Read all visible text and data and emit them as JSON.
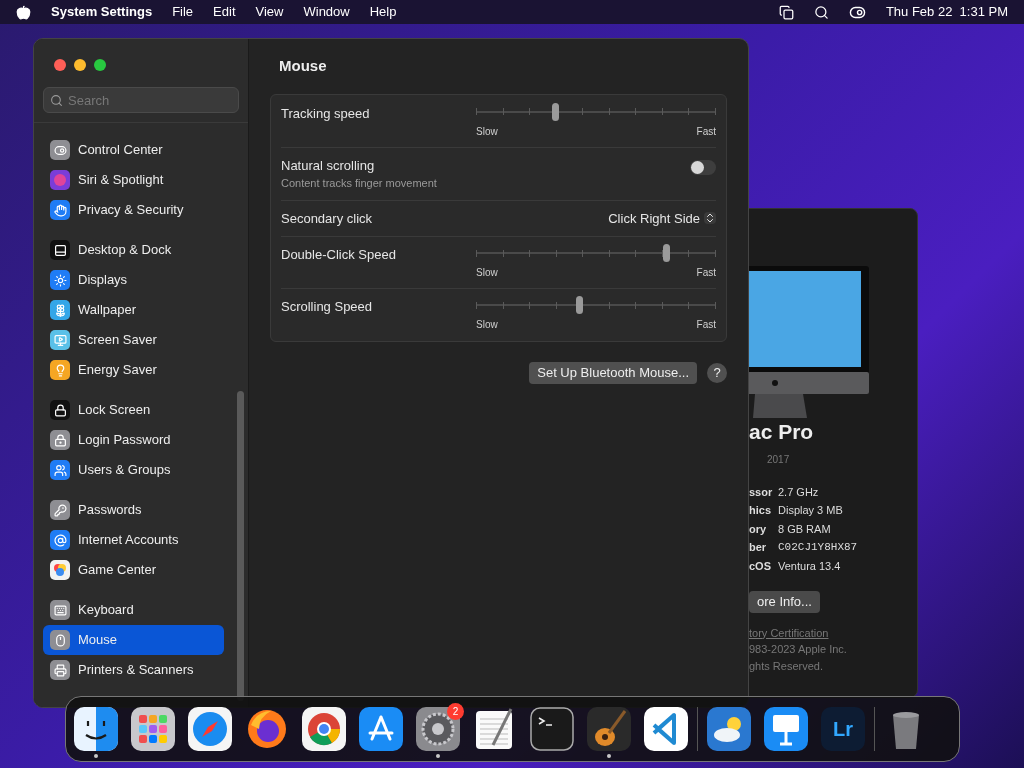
{
  "menu_bar": {
    "app_name": "System Settings",
    "menus": [
      "File",
      "Edit",
      "View",
      "Window",
      "Help"
    ],
    "clock": "Thu Feb 22  1:31 PM"
  },
  "about_window": {
    "model": "ac Pro",
    "year": "2017",
    "specs": [
      {
        "label": "ssor",
        "value": "2.7 GHz"
      },
      {
        "label": "hics",
        "value": "Display 3 MB"
      },
      {
        "label": "ory",
        "value": "8 GB RAM"
      },
      {
        "label": "ber",
        "value": "C02CJ1Y8HX87"
      },
      {
        "label": "cOS",
        "value": "Ventura 13.4"
      }
    ],
    "button": "ore Info...",
    "link": "tory Certification",
    "footer": [
      "983-2023 Apple Inc.",
      "ghts Reserved."
    ]
  },
  "sidebar": {
    "search": {
      "placeholder": "Search"
    },
    "groups": [
      [
        {
          "label": "Control Center",
          "kind": "toggles",
          "color": "#8e8e93",
          "selected": false
        },
        {
          "label": "Siri & Spotlight",
          "kind": "orb",
          "color": "#7a3dd8",
          "selected": false
        },
        {
          "label": "Privacy & Security",
          "kind": "hand",
          "color": "#1f7cf5",
          "selected": false
        }
      ],
      [
        {
          "label": "Desktop & Dock",
          "kind": "dock",
          "color": "#111111",
          "selected": false
        },
        {
          "label": "Displays",
          "kind": "sun",
          "color": "#1f7cf5",
          "selected": false
        },
        {
          "label": "Wallpaper",
          "kind": "flower",
          "color": "#33a6e8",
          "selected": false
        },
        {
          "label": "Screen Saver",
          "kind": "screen",
          "color": "#5ac0e8",
          "selected": false
        },
        {
          "label": "Energy Saver",
          "kind": "bulb",
          "color": "#f5a623",
          "selected": false
        }
      ],
      [
        {
          "label": "Lock Screen",
          "kind": "lock",
          "color": "#111111",
          "selected": false
        },
        {
          "label": "Login Password",
          "kind": "padlock",
          "color": "#8e8e93",
          "selected": false
        },
        {
          "label": "Users & Groups",
          "kind": "users",
          "color": "#1f7cf5",
          "selected": false
        }
      ],
      [
        {
          "label": "Passwords",
          "kind": "key",
          "color": "#8e8e93",
          "selected": false
        },
        {
          "label": "Internet Accounts",
          "kind": "at",
          "color": "#1f7cf5",
          "selected": false
        },
        {
          "label": "Game Center",
          "kind": "bubbles",
          "color": "#f2f2f2",
          "selected": false
        }
      ],
      [
        {
          "label": "Keyboard",
          "kind": "keyboard",
          "color": "#8e8e93",
          "selected": false
        },
        {
          "label": "Mouse",
          "kind": "mouse",
          "color": "#8e8e93",
          "selected": true
        },
        {
          "label": "Printers & Scanners",
          "kind": "printer",
          "color": "#8e8e93",
          "selected": false
        }
      ]
    ]
  },
  "content": {
    "title": "Mouse",
    "rows": [
      {
        "kind": "slider",
        "label": "Tracking speed",
        "level": 0.33,
        "min_label": "Slow",
        "max_label": "Fast"
      },
      {
        "kind": "toggle",
        "label": "Natural scrolling",
        "description": "Content tracks finger movement",
        "on": false
      },
      {
        "kind": "select",
        "label": "Secondary click",
        "value": "Click Right Side"
      },
      {
        "kind": "slider",
        "label": "Double-Click Speed",
        "level": 0.79,
        "min_label": "Slow",
        "max_label": "Fast"
      },
      {
        "kind": "slider",
        "label": "Scrolling Speed",
        "level": 0.43,
        "min_label": "Slow",
        "max_label": "Fast"
      }
    ],
    "button": "Set Up Bluetooth Mouse...",
    "help": "?"
  },
  "dock": [
    [
      {
        "kind": "finder",
        "running": true
      },
      {
        "kind": "launchpad",
        "running": false
      },
      {
        "kind": "safari",
        "running": false
      },
      {
        "kind": "firefox",
        "running": false
      },
      {
        "kind": "chrome",
        "running": false
      },
      {
        "kind": "appstore",
        "running": false
      },
      {
        "kind": "settings",
        "running": true,
        "badge": "2"
      },
      {
        "kind": "textedit",
        "running": false
      },
      {
        "kind": "terminal",
        "running": false
      },
      {
        "kind": "garageband",
        "running": true
      },
      {
        "kind": "vscode",
        "running": false
      }
    ],
    [
      {
        "kind": "weather",
        "running": false
      },
      {
        "kind": "keynote",
        "running": false
      },
      {
        "kind": "lightroom",
        "running": false,
        "text": "Lr"
      }
    ],
    [
      {
        "kind": "trash",
        "running": false
      }
    ]
  ]
}
